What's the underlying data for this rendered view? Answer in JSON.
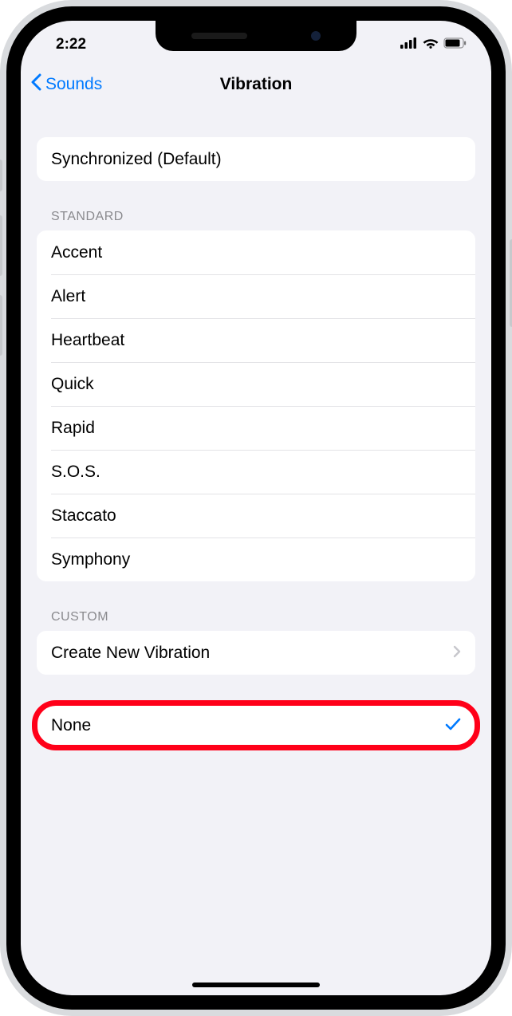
{
  "status": {
    "time": "2:22"
  },
  "nav": {
    "back_label": "Sounds",
    "title": "Vibration"
  },
  "sections": {
    "default_item": "Synchronized (Default)",
    "standard_header": "STANDARD",
    "standard_items": [
      "Accent",
      "Alert",
      "Heartbeat",
      "Quick",
      "Rapid",
      "S.O.S.",
      "Staccato",
      "Symphony"
    ],
    "custom_header": "CUSTOM",
    "custom_item": "Create New Vibration",
    "none_item": "None"
  },
  "selected": "None"
}
